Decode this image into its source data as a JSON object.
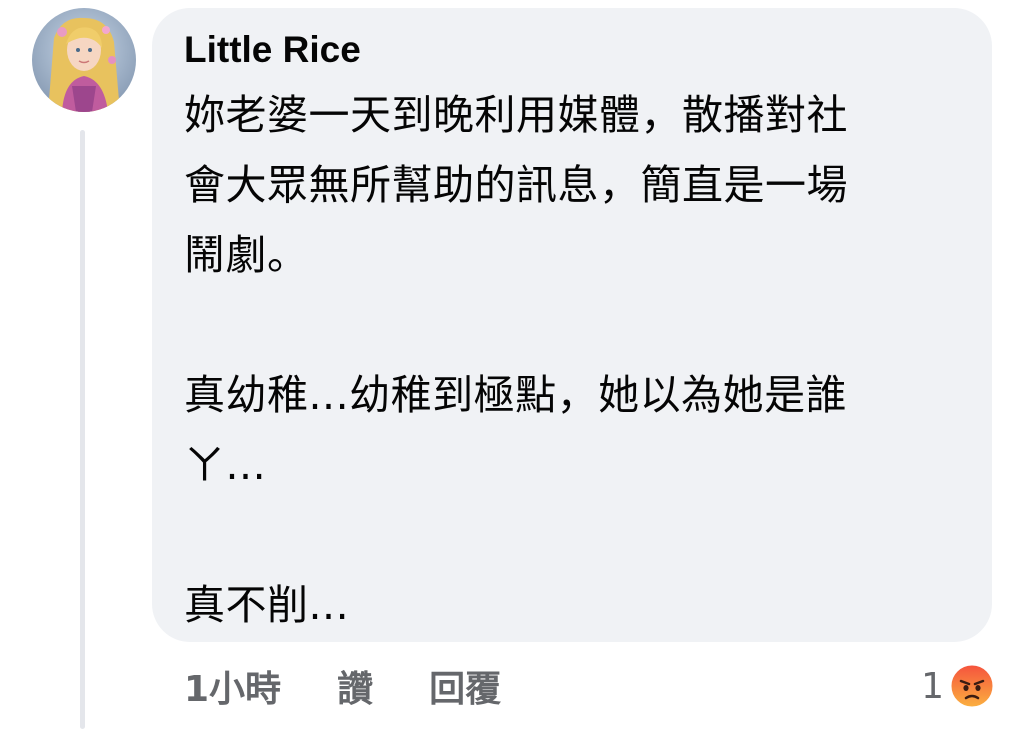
{
  "comment": {
    "author": "Little Rice",
    "text_lines": [
      "妳老婆一天到晚利用媒體，散播對社",
      "會大眾無所幫助的訊息，簡直是一場",
      "鬧劇。",
      "",
      "真幼稚...幼稚到極點，她以為她是誰",
      "ㄚ...",
      "",
      "真不削..."
    ]
  },
  "actions": {
    "time": "1小時",
    "like": "讚",
    "reply": "回覆"
  },
  "reactions": {
    "count": "1",
    "icon": "angry-reaction-icon"
  },
  "colors": {
    "bubble": "#f0f2f5",
    "meta_text": "#65676b",
    "angry_reaction": "#f5533d"
  }
}
